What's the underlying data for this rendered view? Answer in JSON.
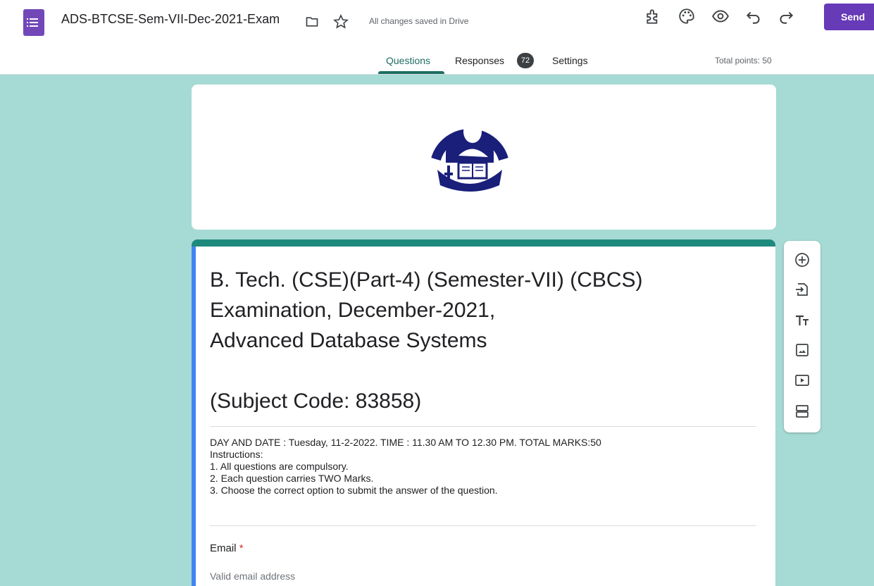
{
  "app": {
    "icon": "google-forms-icon",
    "title": "ADS-BTCSE-Sem-VII-Dec-2021-Exam",
    "save_status": "All changes saved in Drive",
    "send_label": "Send",
    "toolbar_icons": [
      "addon-icon",
      "palette-icon",
      "preview-eye-icon",
      "undo-icon",
      "redo-icon"
    ],
    "accent_color": "#673ab7"
  },
  "tabs": {
    "questions": "Questions",
    "responses": "Responses",
    "responses_count": "72",
    "settings": "Settings",
    "active": "Questions"
  },
  "total_points": "Total points: 50",
  "form": {
    "title": "B. Tech. (CSE)(Part-4) (Semester-VII) (CBCS) Examination, December-2021,\n Advanced Database Systems\n\n (Subject Code: 83858)",
    "description": "DAY AND DATE : Tuesday, 11-2-2022.  TIME : 11.30 AM TO 12.30 PM.  TOTAL MARKS:50\nInstructions:\n1.   All questions are compulsory.\n2.   Each question carries TWO Marks.\n3.   Choose the correct option to submit the answer of the question.",
    "email_label": "Email",
    "email_required_mark": "*",
    "email_placeholder": "Valid email address",
    "theme_color": "#a6dad4",
    "header_accent": "#1e8a7d"
  },
  "side_toolbar": [
    "add-question-icon",
    "import-questions-icon",
    "add-title-icon",
    "add-image-icon",
    "add-video-icon",
    "add-section-icon"
  ]
}
